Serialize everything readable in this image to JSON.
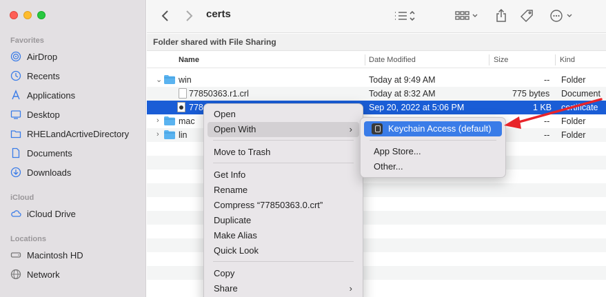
{
  "toolbar": {
    "back_icon": "chevron-left-icon",
    "forward_icon": "chevron-right-icon",
    "title": "certs"
  },
  "shared_bar": {
    "text": "Folder shared with File Sharing"
  },
  "sidebar": {
    "sections": [
      {
        "label": "Favorites",
        "items": [
          {
            "label": "AirDrop",
            "icon": "airdrop-icon"
          },
          {
            "label": "Recents",
            "icon": "clock-icon"
          },
          {
            "label": "Applications",
            "icon": "applications-icon"
          },
          {
            "label": "Desktop",
            "icon": "desktop-icon"
          },
          {
            "label": "RHELandAcrtiveDirectory",
            "icon": "folder-icon"
          },
          {
            "label": "Documents",
            "icon": "document-icon"
          },
          {
            "label": "Downloads",
            "icon": "download-icon"
          }
        ]
      },
      {
        "label": "iCloud",
        "items": [
          {
            "label": "iCloud Drive",
            "icon": "cloud-icon"
          }
        ]
      },
      {
        "label": "Locations",
        "items": [
          {
            "label": "Macintosh HD",
            "icon": "disk-icon"
          },
          {
            "label": "Network",
            "icon": "network-icon"
          }
        ]
      }
    ]
  },
  "columns": {
    "name": "Name",
    "date": "Date Modified",
    "size": "Size",
    "kind": "Kind"
  },
  "rows": [
    {
      "name": "win",
      "date": "Today at 9:49 AM",
      "size": "--",
      "kind": "Folder"
    },
    {
      "name": "77850363.r1.crl",
      "date": "Today at 8:32 AM",
      "size": "775 bytes",
      "kind": "Document"
    },
    {
      "name": "778",
      "date": "Sep 20, 2022 at 5:06 PM",
      "size": "1 KB",
      "kind": "certificate"
    },
    {
      "name": "mac",
      "date": "",
      "size": "--",
      "kind": "Folder"
    },
    {
      "name": "lin",
      "date": "",
      "size": "--",
      "kind": "Folder"
    }
  ],
  "context_menu": {
    "open": "Open",
    "open_with": "Open With",
    "move_to_trash": "Move to Trash",
    "get_info": "Get Info",
    "rename": "Rename",
    "compress": "Compress “77850363.0.crt”",
    "duplicate": "Duplicate",
    "make_alias": "Make Alias",
    "quick_look": "Quick Look",
    "copy": "Copy",
    "share": "Share"
  },
  "submenu": {
    "keychain": "Keychain Access (default)",
    "app_store": "App Store...",
    "other": "Other..."
  },
  "colors": {
    "selection": "#1a5dd6",
    "highlight": "#3a7ce8",
    "arrow": "#e8242a"
  }
}
